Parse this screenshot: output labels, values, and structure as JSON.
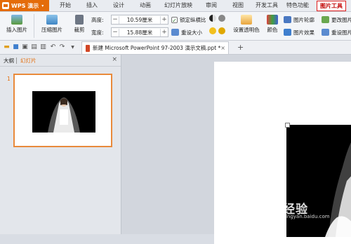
{
  "app": {
    "menu_label": "WPS 演示",
    "menu_arrow": "▾"
  },
  "menu_tabs": [
    {
      "label": "开始"
    },
    {
      "label": "插入"
    },
    {
      "label": "设计"
    },
    {
      "label": "动画"
    },
    {
      "label": "幻灯片放映"
    },
    {
      "label": "审阅"
    },
    {
      "label": "视图"
    },
    {
      "label": "开发工具"
    },
    {
      "label": "特色功能"
    },
    {
      "label": "图片工具"
    }
  ],
  "ribbon": {
    "insert_picture": "插入图片",
    "compress_picture": "压缩图片",
    "crop": "裁剪",
    "height_label": "高度:",
    "height_value": "10.59厘米",
    "width_label": "宽度:",
    "width_value": "15.88厘米",
    "minus": "−",
    "plus": "+",
    "lock_ratio": "锁定纵横比",
    "reset_size": "重设大小",
    "set_transparent": "设置透明色",
    "color": "颜色",
    "picture_outline": "图片轮廓",
    "picture_effect": "图片效果",
    "change_picture": "更改图片",
    "reset_picture": "重设图片"
  },
  "quickbar": {
    "doc_tab_name": "新建 Microsoft PowerPoint 97-2003 演示文稿.ppt *",
    "close": "×",
    "add": "+"
  },
  "left_panel": {
    "tab_outline": "大纲",
    "tab_slides": "幻灯片",
    "close": "×",
    "slide_number": "1"
  },
  "watermark": {
    "brand": "Bai 经验",
    "url": "jingyan.baidu.com"
  },
  "colors": {
    "accent": "#e46c0a",
    "highlight": "#e02020"
  }
}
